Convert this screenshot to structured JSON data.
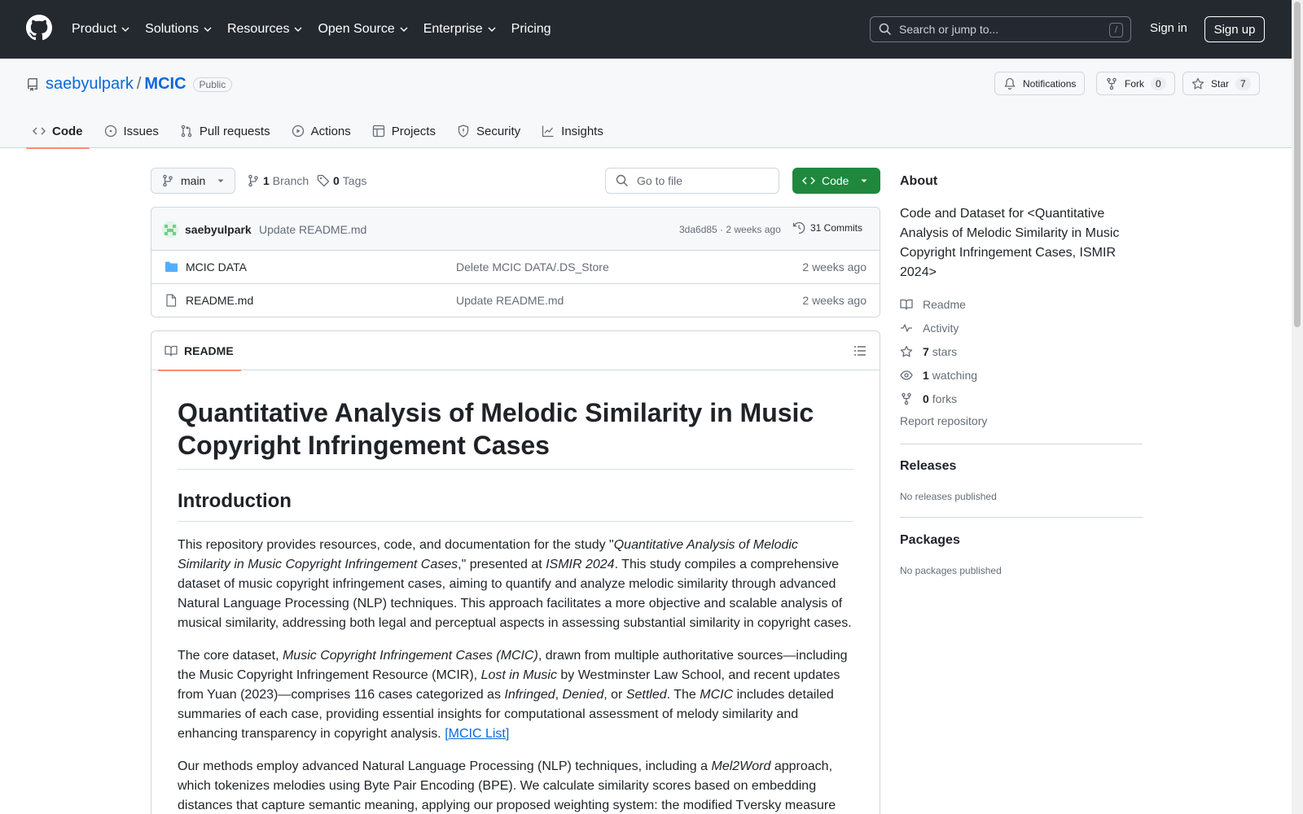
{
  "header": {
    "nav": [
      {
        "label": "Product",
        "dropdown": true
      },
      {
        "label": "Solutions",
        "dropdown": true
      },
      {
        "label": "Resources",
        "dropdown": true
      },
      {
        "label": "Open Source",
        "dropdown": true
      },
      {
        "label": "Enterprise",
        "dropdown": true
      },
      {
        "label": "Pricing",
        "dropdown": false
      }
    ],
    "search_placeholder": "Search or jump to...",
    "search_shortcut": "/",
    "sign_in": "Sign in",
    "sign_up": "Sign up"
  },
  "repo": {
    "owner": "saebyulpark",
    "separator": "/",
    "name": "MCIC",
    "visibility": "Public",
    "notifications_label": "Notifications",
    "fork_label": "Fork",
    "fork_count": "0",
    "star_label": "Star",
    "star_count": "7",
    "tabs": [
      {
        "label": "Code",
        "icon": "code-icon"
      },
      {
        "label": "Issues",
        "icon": "issue-icon"
      },
      {
        "label": "Pull requests",
        "icon": "pull-request-icon"
      },
      {
        "label": "Actions",
        "icon": "play-icon"
      },
      {
        "label": "Projects",
        "icon": "table-icon"
      },
      {
        "label": "Security",
        "icon": "shield-icon"
      },
      {
        "label": "Insights",
        "icon": "graph-icon"
      }
    ]
  },
  "toolbar": {
    "branch": "main",
    "branch_count": "1",
    "branch_label": "Branch",
    "tag_count": "0",
    "tag_label": "Tags",
    "goto_placeholder": "Go to file",
    "code_button": "Code"
  },
  "latest_commit": {
    "author": "saebyulpark",
    "message": "Update README.md",
    "sha_time": "3da6d85 · 2 weeks ago",
    "commits": "31 Commits"
  },
  "files": [
    {
      "name": "MCIC DATA",
      "type": "folder",
      "message": "Delete MCIC DATA/.DS_Store",
      "time": "2 weeks ago"
    },
    {
      "name": "README.md",
      "type": "file",
      "message": "Update README.md",
      "time": "2 weeks ago"
    }
  ],
  "readme": {
    "tab_label": "README",
    "h1": "Quantitative Analysis of Melodic Similarity in Music Copyright Infringement Cases",
    "h2": "Introduction",
    "p1": [
      {
        "t": "This repository provides resources, code, and documentation for the study \""
      },
      {
        "t": "Quantitative Analysis of Melodic Similarity in Music Copyright Infringement Cases",
        "i": true
      },
      {
        "t": ",\" presented at "
      },
      {
        "t": "ISMIR 2024",
        "i": true
      },
      {
        "t": ". This study compiles a comprehensive dataset of music copyright infringement cases, aiming to quantify and analyze melodic similarity through advanced Natural Language Processing (NLP) techniques. This approach facilitates a more objective and scalable analysis of musical similarity, addressing both legal and perceptual aspects in assessing substantial similarity in copyright cases."
      }
    ],
    "p2": [
      {
        "t": "The core dataset, "
      },
      {
        "t": "Music Copyright Infringement Cases (MCIC)",
        "i": true
      },
      {
        "t": ", drawn from multiple authoritative sources—including the Music Copyright Infringement Resource (MCIR), "
      },
      {
        "t": "Lost in Music",
        "i": true
      },
      {
        "t": " by Westminster Law School, and recent updates from Yuan (2023)—comprises 116 cases categorized as "
      },
      {
        "t": "Infringed",
        "i": true
      },
      {
        "t": ", "
      },
      {
        "t": "Denied",
        "i": true
      },
      {
        "t": ", or "
      },
      {
        "t": "Settled",
        "i": true
      },
      {
        "t": ". The "
      },
      {
        "t": "MCIC",
        "i": true
      },
      {
        "t": " includes detailed summaries of each case, providing essential insights for computational assessment of melody similarity and enhancing transparency in copyright analysis. "
      },
      {
        "t": "[MCIC List]",
        "link": true
      }
    ],
    "p3": [
      {
        "t": "Our methods employ advanced Natural Language Processing (NLP) techniques, including a "
      },
      {
        "t": "Mel2Word",
        "i": true
      },
      {
        "t": " approach, which tokenizes melodies using Byte Pair Encoding (BPE). We calculate similarity scores based on embedding distances that capture semantic meaning, applying our proposed weighting system: the modified Tversky measure"
      }
    ]
  },
  "sidebar": {
    "about_title": "About",
    "description": "Code and Dataset for <Quantitative Analysis of Melodic Similarity in Music Copyright Infringement Cases, ISMIR 2024>",
    "readme": "Readme",
    "activity": "Activity",
    "stars_count": "7",
    "stars_label": "stars",
    "watching_count": "1",
    "watching_label": "watching",
    "forks_count": "0",
    "forks_label": "forks",
    "report": "Report repository",
    "releases_title": "Releases",
    "releases_text": "No releases published",
    "packages_title": "Packages",
    "packages_text": "No packages published"
  },
  "colors": {
    "header_bg": "#24292f",
    "link": "#0969da",
    "primary_button": "#1f883d",
    "active_tab_underline": "#fd8c73",
    "border": "#d0d7de",
    "muted_text": "#656d76"
  }
}
